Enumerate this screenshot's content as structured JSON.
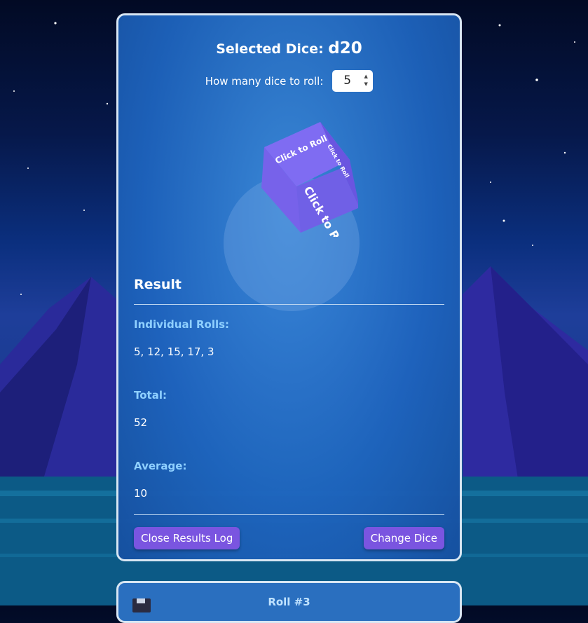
{
  "panel": {
    "selected_label": "Selected Dice:",
    "selected_dice": "d20",
    "count_label": "How many dice to roll:",
    "count_value": "5",
    "cube_face_front": "Click to Roll",
    "cube_face_top": "Click to Roll",
    "cube_face_side": "Click to Roll"
  },
  "result": {
    "heading": "Result",
    "individual_label": "Individual Rolls:",
    "individual_value": "5, 12, 15, 17, 3",
    "total_label": "Total:",
    "total_value": "52",
    "average_label": "Average:",
    "average_value": "10"
  },
  "buttons": {
    "close_log": "Close Results Log",
    "change_dice": "Change Dice"
  },
  "log": {
    "roll_title": "Roll #3"
  },
  "colors": {
    "accent": "#7a55e0",
    "label_blue": "#8fd0ff"
  }
}
